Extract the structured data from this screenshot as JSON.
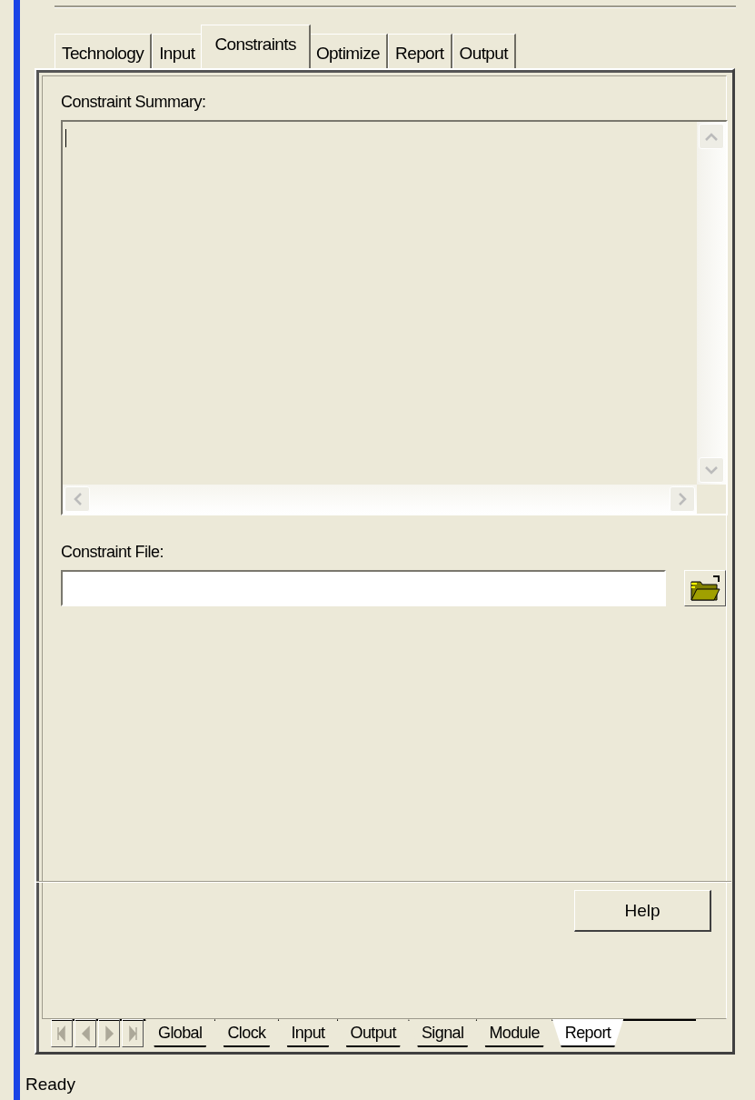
{
  "tabs": [
    {
      "label": "Technology",
      "selected": false
    },
    {
      "label": "Input",
      "selected": false
    },
    {
      "label": "Constraints",
      "selected": true
    },
    {
      "label": "Optimize",
      "selected": false
    },
    {
      "label": "Report",
      "selected": false
    },
    {
      "label": "Output",
      "selected": false
    }
  ],
  "summary": {
    "label": "Constraint Summary:"
  },
  "constraint_file": {
    "label": "Constraint File:"
  },
  "help_button": "Help",
  "sheet_tabs": [
    {
      "label": "Global",
      "selected": false
    },
    {
      "label": "Clock",
      "selected": false
    },
    {
      "label": "Input",
      "selected": false
    },
    {
      "label": "Output",
      "selected": false
    },
    {
      "label": "Signal",
      "selected": false
    },
    {
      "label": "Module",
      "selected": false
    },
    {
      "label": "Report",
      "selected": true
    }
  ],
  "status_bar": "Ready"
}
